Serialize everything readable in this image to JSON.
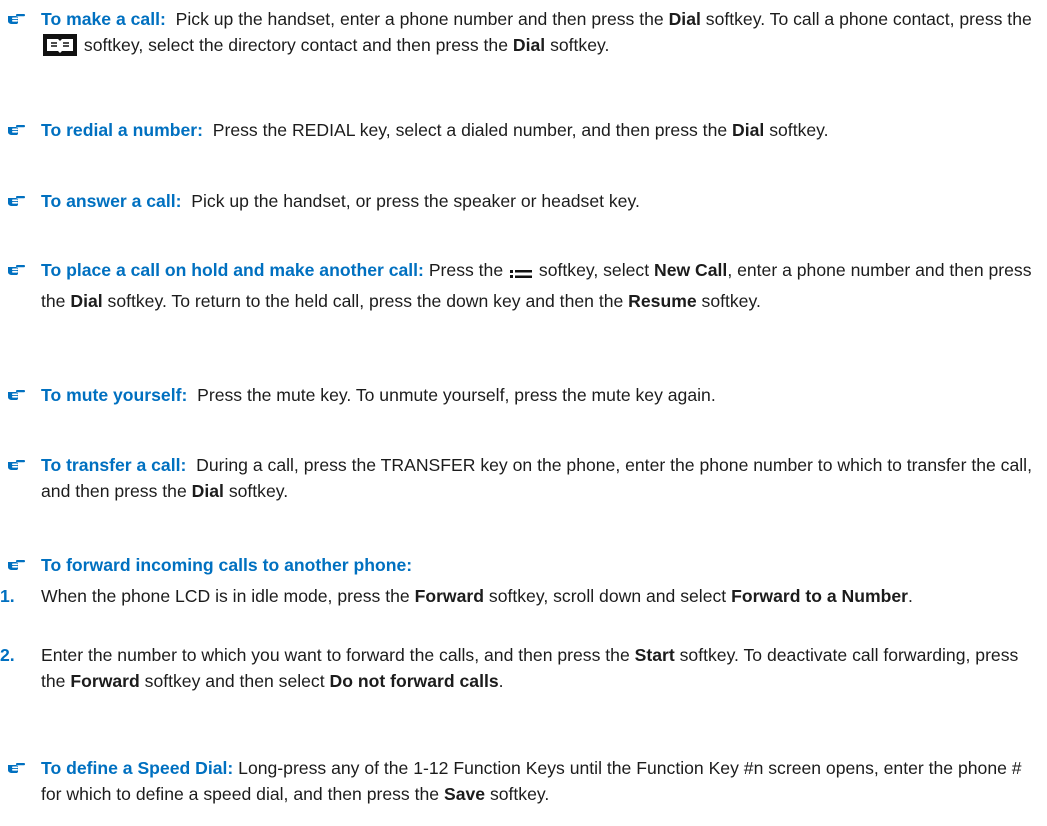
{
  "colors": {
    "heading": "#0070c0",
    "text": "#1c1c1c"
  },
  "icons": {
    "bullet": "pointing-hand-icon",
    "directory_softkey": "directory-softkey-icon",
    "menu_softkey": "menu-list-icon"
  },
  "items": {
    "make_call": {
      "heading": "To make a call:",
      "t1": "Pick up the handset, enter a phone number and then press the",
      "b1": "Dial",
      "t2": "softkey. To call a phone contact, press the",
      "t3": "softkey, select the directory contact and then press the",
      "b2": "Dial",
      "t4": "softkey."
    },
    "redial": {
      "heading": "To redial a number:",
      "t1": "Press the REDIAL key, select a dialed number, and then press the",
      "b1": "Dial",
      "t2": "softkey."
    },
    "answer": {
      "heading": "To answer a call:",
      "t1": "Pick up the handset, or press the speaker or headset key."
    },
    "hold": {
      "heading": "To place a call on hold and make another call:",
      "t1": "Press the",
      "t2": "softkey, select",
      "b1": "New Call",
      "t3": ", enter a phone number and then press the",
      "b2": "Dial",
      "t4": "softkey. To return to the held call, press the down key and then the",
      "b3": "Resume",
      "t5": "softkey."
    },
    "mute": {
      "heading": "To mute yourself:",
      "t1": "Press the mute key. To unmute yourself, press the mute key again."
    },
    "transfer": {
      "heading": "To transfer a call:",
      "t1": "During a call, press the TRANSFER key on the phone, enter the phone number to which to transfer the call, and then press the",
      "b1": "Dial",
      "t2": "softkey."
    },
    "forward": {
      "heading": "To forward incoming calls to another phone:",
      "step1": {
        "num": "1.",
        "t1": "When the phone LCD is in idle mode, press the",
        "b1": "Forward",
        "t2": "softkey, scroll down and select",
        "b2": "Forward to a Number",
        "t3": "."
      },
      "step2": {
        "num": "2.",
        "t1": "Enter the number to which you want to forward the calls, and then press the",
        "b1": "Start",
        "t2": "softkey. To deactivate call forwarding, press the",
        "b2": "Forward",
        "t3": "softkey and then select",
        "b3": "Do not forward calls",
        "t4": "."
      }
    },
    "speed_dial": {
      "heading": "To define a Speed Dial:",
      "t1": "Long-press any of the 1-12 Function Keys until the Function Key #n screen opens, enter the phone # for which to define a speed dial, and then press the",
      "b1": "Save",
      "t2": "softkey."
    }
  }
}
